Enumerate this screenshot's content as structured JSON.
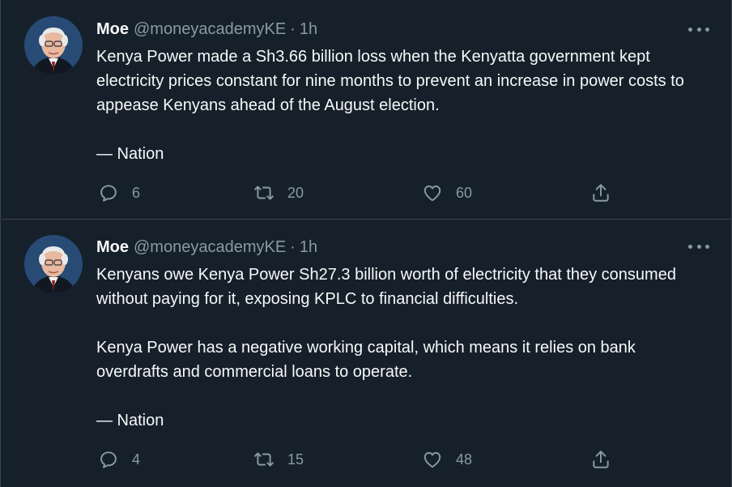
{
  "theme": {
    "background": "#15202b",
    "border": "#38444d",
    "text_primary": "#f7f9f9",
    "text_secondary": "#8b98a5"
  },
  "tweets": [
    {
      "author_name": "Moe",
      "handle": "@moneyacademyKE",
      "separator": "·",
      "time": "1h",
      "paragraphs": [
        "Kenya Power made a Sh3.66 billion loss when the Kenyatta government kept electricity prices constant for nine months to prevent an increase in power costs to appease Kenyans ahead of the August election.",
        "— Nation"
      ],
      "replies": "6",
      "retweets": "20",
      "likes": "60"
    },
    {
      "author_name": "Moe",
      "handle": "@moneyacademyKE",
      "separator": "·",
      "time": "1h",
      "paragraphs": [
        "Kenyans owe Kenya Power Sh27.3 billion worth of electricity that they consumed without paying for it, exposing KPLC to financial difficulties.",
        "Kenya Power has a negative working capital, which means it relies on bank overdrafts and commercial loans to operate.",
        "— Nation"
      ],
      "replies": "4",
      "retweets": "15",
      "likes": "48"
    }
  ],
  "icons": {
    "more": "more-horizontal-icon",
    "reply": "reply-icon",
    "retweet": "retweet-icon",
    "like": "heart-icon",
    "share": "share-icon"
  }
}
